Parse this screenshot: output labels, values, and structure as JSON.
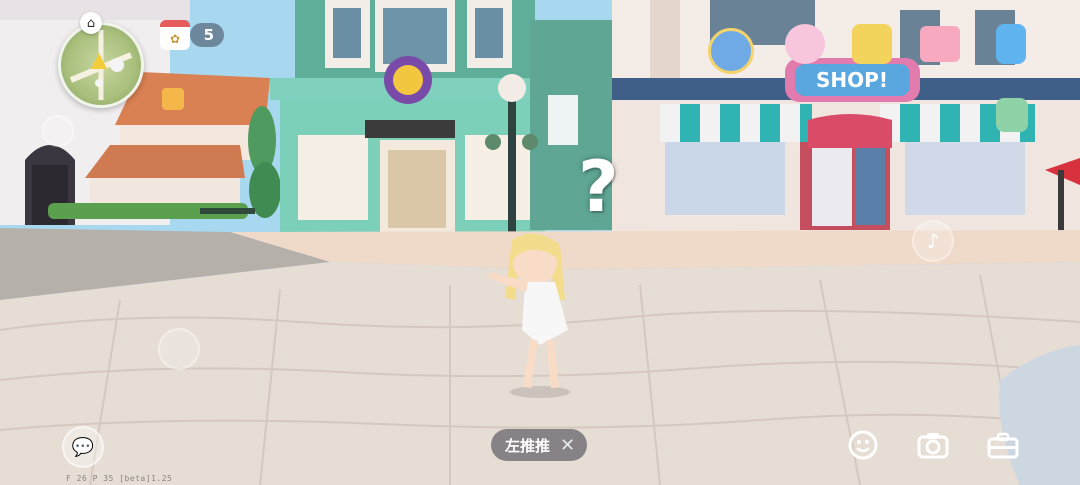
{
  "hud": {
    "day_count": "5",
    "question_mark": "?",
    "action_label": "左推推",
    "action_close": "✕",
    "debug_text": "F 26   P 35   [beta]1.25"
  },
  "scene": {
    "shop_sign": "SHOP!"
  },
  "icons": {
    "home": "home-icon",
    "calendar": "calendar-icon",
    "chat": "chat-icon",
    "emote": "smiley-icon",
    "camera": "camera-icon",
    "bag": "toolbox-icon",
    "planet": "planet-icon",
    "cart": "basket-icon",
    "phone": "phone-icon",
    "backpack": "backpack-icon",
    "dance": "dance-icon"
  },
  "colors": {
    "sky": "#9fd0ec",
    "plaza": "#e5ddd6",
    "teal_shop": "#6fc2ad",
    "awning": "#2fb3b3",
    "accent_red": "#e65b5b"
  }
}
